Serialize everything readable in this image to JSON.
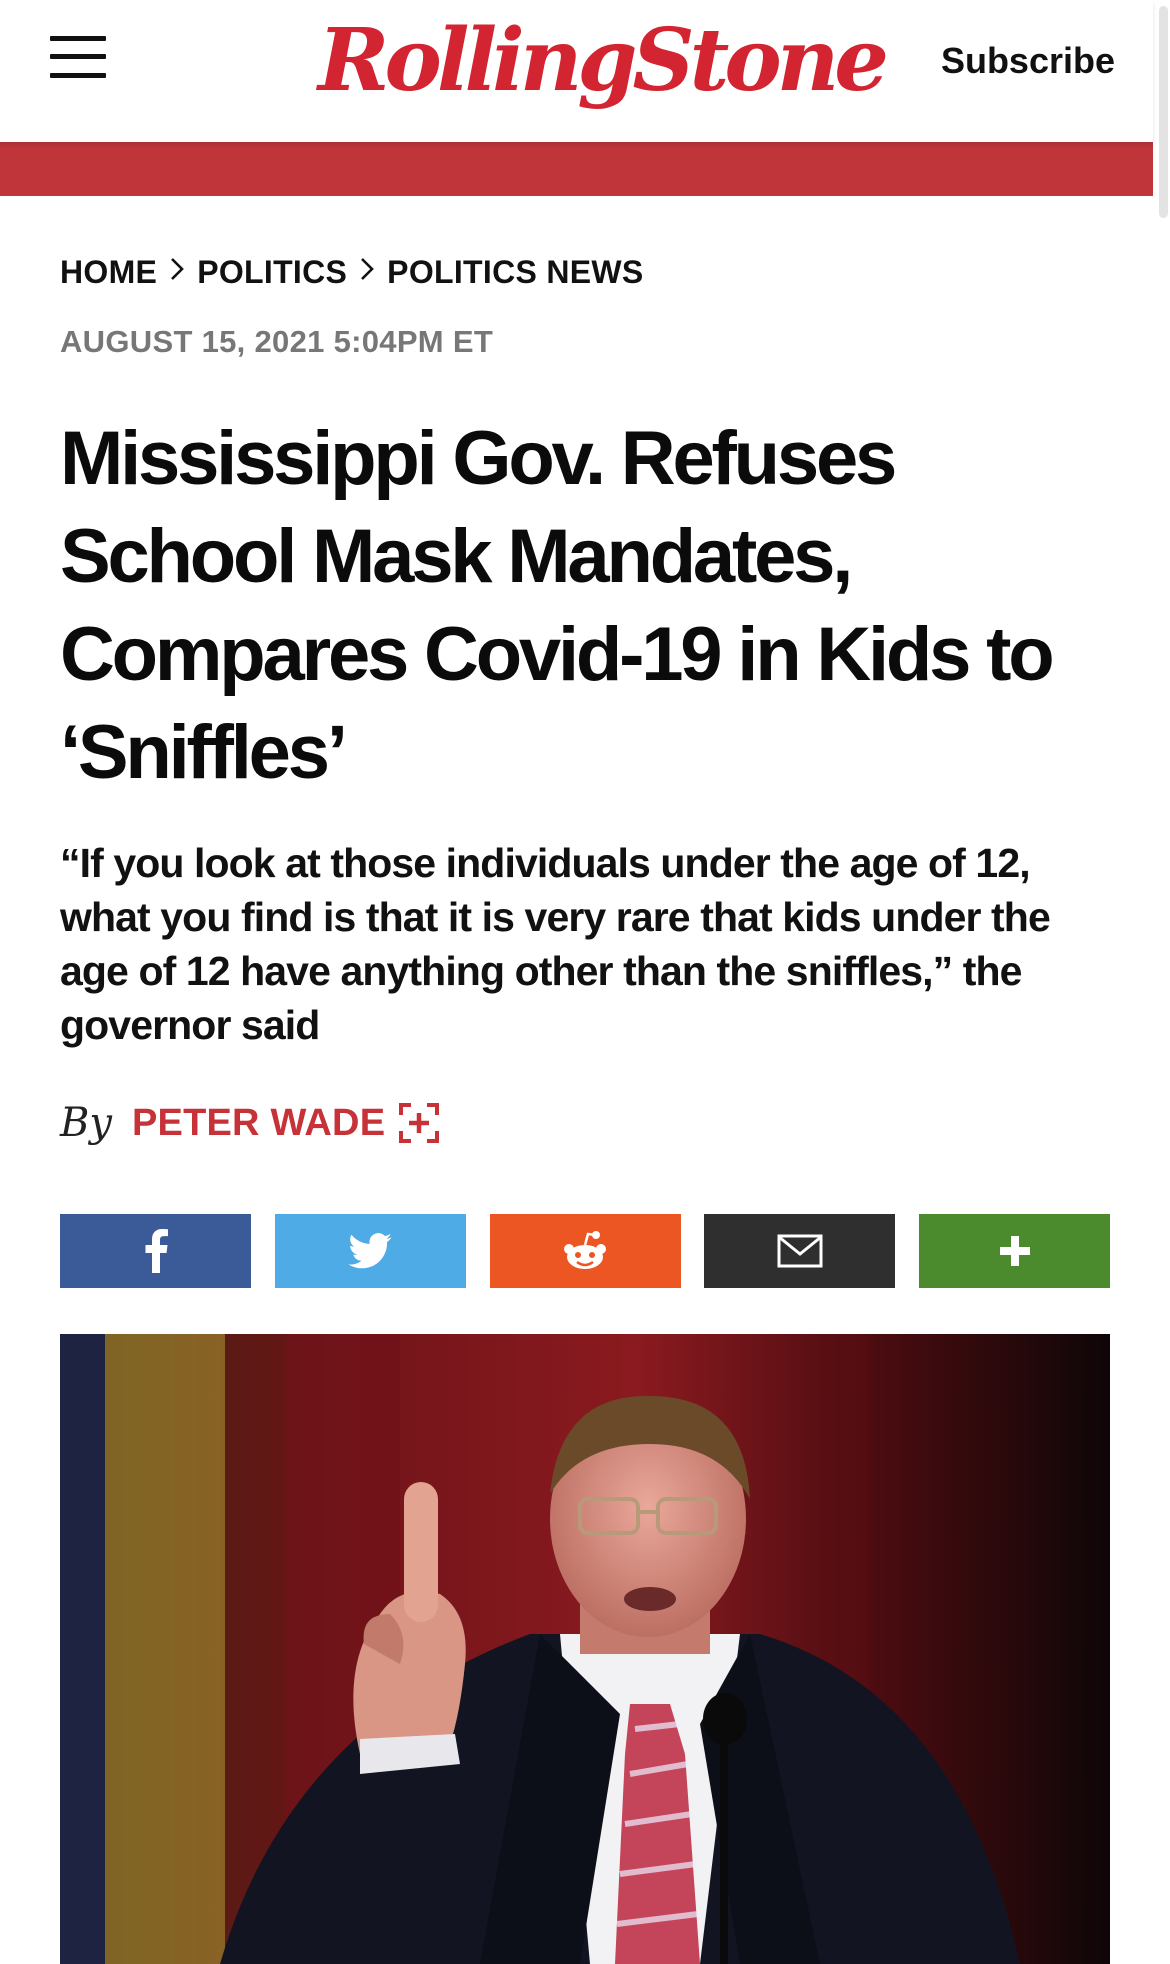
{
  "header": {
    "logo_text": "RollingStone",
    "subscribe_label": "Subscribe",
    "brand_color": "#d32531",
    "band_color": "#c0353a"
  },
  "breadcrumb": {
    "items": [
      "HOME",
      "POLITICS",
      "POLITICS NEWS"
    ],
    "separator": "›"
  },
  "article": {
    "dateline": "AUGUST 15, 2021 5:04PM ET",
    "headline": "Mississippi Gov. Refuses School Mask Mandates, Compares Covid-19 in Kids to ‘Sniffles’",
    "dek": "“If you look at those individuals under the age of 12, what you find is that it is very rare that kids under the age of 12 have anything other than the sniffles,” the governor said",
    "byline_prefix": "By",
    "author": "PETER WADE",
    "author_color": "#c63238"
  },
  "share": {
    "buttons": [
      {
        "name": "facebook",
        "icon": "facebook-icon",
        "color": "#3b5b98"
      },
      {
        "name": "twitter",
        "icon": "twitter-bird-icon",
        "color": "#4eabe6"
      },
      {
        "name": "reddit",
        "icon": "reddit-alien-icon",
        "color": "#ec5623"
      },
      {
        "name": "email",
        "icon": "envelope-icon",
        "color": "#2f2f2f"
      },
      {
        "name": "more",
        "icon": "plus-icon",
        "color": "#4c8a2e"
      }
    ],
    "facebook_glyph": "f",
    "more_glyph": "+"
  },
  "photo": {
    "subject": "man-in-suit-raising-index-finger-photo"
  }
}
